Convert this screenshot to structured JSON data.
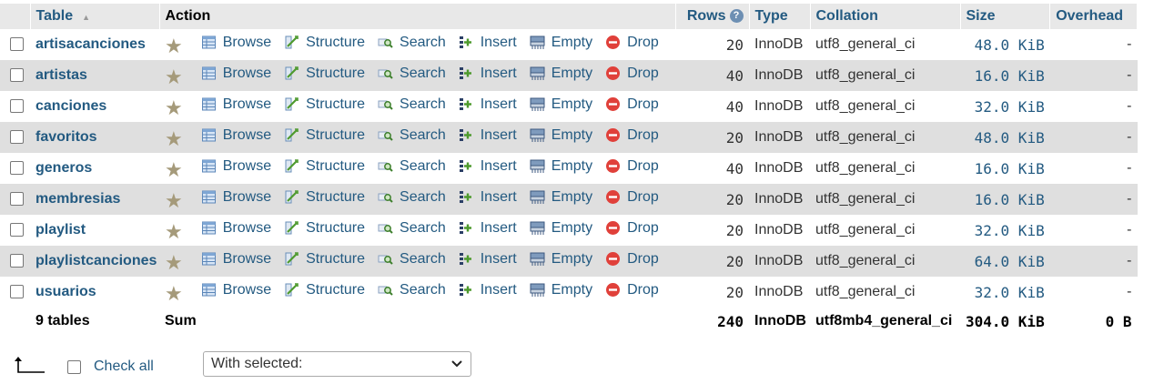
{
  "headers": {
    "table": "Table",
    "action": "Action",
    "rows": "Rows",
    "rows_help": "?",
    "type": "Type",
    "collation": "Collation",
    "size": "Size",
    "overhead": "Overhead"
  },
  "actions": {
    "browse": "Browse",
    "structure": "Structure",
    "search": "Search",
    "insert": "Insert",
    "empty": "Empty",
    "drop": "Drop"
  },
  "icons": {
    "sort": "sort-asc-icon",
    "favorite": "star-icon",
    "browse": "browse-icon",
    "structure": "structure-icon",
    "search": "search-icon",
    "insert": "insert-icon",
    "empty": "empty-icon",
    "drop": "drop-icon"
  },
  "rows": [
    {
      "name": "artisacanciones",
      "rows": "20",
      "type": "InnoDB",
      "collation": "utf8_general_ci",
      "size": "48.0 KiB",
      "overhead": "-"
    },
    {
      "name": "artistas",
      "rows": "40",
      "type": "InnoDB",
      "collation": "utf8_general_ci",
      "size": "16.0 KiB",
      "overhead": "-"
    },
    {
      "name": "canciones",
      "rows": "40",
      "type": "InnoDB",
      "collation": "utf8_general_ci",
      "size": "32.0 KiB",
      "overhead": "-"
    },
    {
      "name": "favoritos",
      "rows": "20",
      "type": "InnoDB",
      "collation": "utf8_general_ci",
      "size": "48.0 KiB",
      "overhead": "-"
    },
    {
      "name": "generos",
      "rows": "40",
      "type": "InnoDB",
      "collation": "utf8_general_ci",
      "size": "16.0 KiB",
      "overhead": "-"
    },
    {
      "name": "membresias",
      "rows": "20",
      "type": "InnoDB",
      "collation": "utf8_general_ci",
      "size": "16.0 KiB",
      "overhead": "-"
    },
    {
      "name": "playlist",
      "rows": "20",
      "type": "InnoDB",
      "collation": "utf8_general_ci",
      "size": "32.0 KiB",
      "overhead": "-"
    },
    {
      "name": "playlistcanciones",
      "rows": "20",
      "type": "InnoDB",
      "collation": "utf8_general_ci",
      "size": "64.0 KiB",
      "overhead": "-"
    },
    {
      "name": "usuarios",
      "rows": "20",
      "type": "InnoDB",
      "collation": "utf8_general_ci",
      "size": "32.0 KiB",
      "overhead": "-"
    }
  ],
  "footer": {
    "count": "9 tables",
    "sum": "Sum",
    "rows": "240",
    "type": "InnoDB",
    "collation": "utf8mb4_general_ci",
    "size": "304.0 KiB",
    "overhead": "0 B"
  },
  "bottom": {
    "check_all": "Check all",
    "with_selected": "With selected:"
  }
}
